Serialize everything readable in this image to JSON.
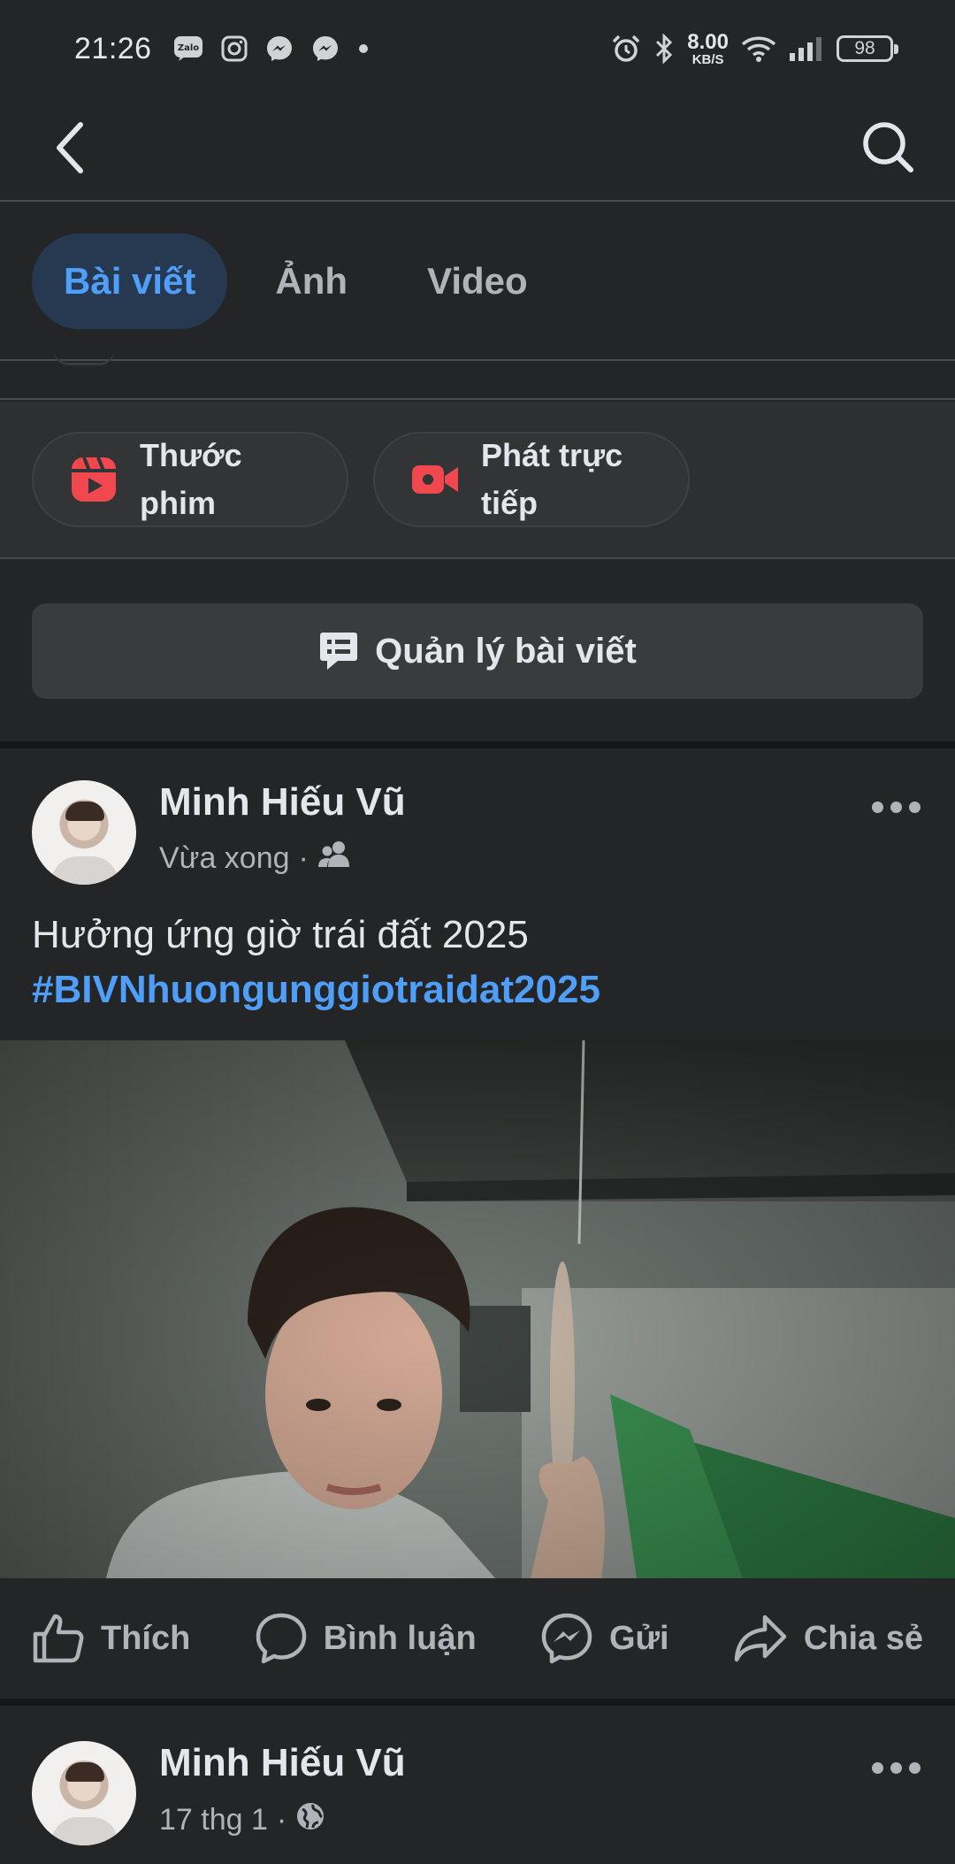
{
  "status_bar": {
    "time": "21:26",
    "speed_value": "8.00",
    "speed_unit": "KB/S",
    "battery": "98",
    "icons_left": [
      "zalo-icon",
      "instagram-icon",
      "messenger-icon",
      "messenger-icon",
      "dot-icon"
    ],
    "icons_right": [
      "alarm-icon",
      "bluetooth-icon",
      "wifi-icon",
      "signal-icon",
      "battery-icon"
    ]
  },
  "tabs": [
    {
      "label": "Bài viết",
      "active": true
    },
    {
      "label": "Ảnh",
      "active": false
    },
    {
      "label": "Video",
      "active": false
    }
  ],
  "create": {
    "reels_line1": "Thước",
    "reels_line2": "phim",
    "live_line1": "Phát trực",
    "live_line2": "tiếp"
  },
  "manage_posts_label": "Quản lý bài viết",
  "posts": [
    {
      "author": "Minh Hiếu Vũ",
      "time": "Vừa xong",
      "separator": "·",
      "audience_icon": "friends-icon",
      "text": "Hưởng ứng giờ trái đất 2025",
      "hashtag": "#BIVNhuongunggiotraidat2025"
    },
    {
      "author": "Minh Hiếu Vũ",
      "time": "17 thg 1",
      "separator": "·",
      "audience_icon": "globe-icon"
    }
  ],
  "actions": {
    "like": "Thích",
    "comment": "Bình luận",
    "send": "Gửi",
    "share": "Chia sẻ"
  },
  "colors": {
    "background": "#242527",
    "accent_blue": "#4f9ef8",
    "active_tab_bg": "#263951",
    "reels_red": "#f0484e",
    "text_secondary": "#b0b3b8"
  }
}
